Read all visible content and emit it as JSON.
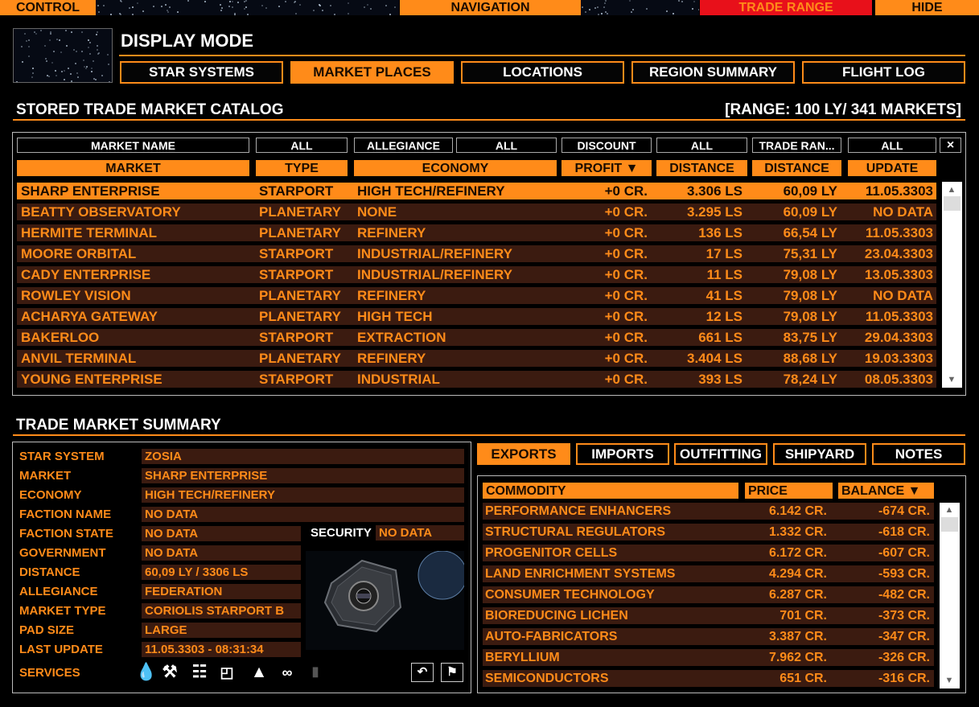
{
  "topbar": {
    "control": "CONTROL",
    "navigation": "NAVIGATION",
    "trade_range": "TRADE RANGE",
    "hide": "HIDE"
  },
  "display_mode": {
    "title": "DISPLAY MODE",
    "buttons": [
      "STAR SYSTEMS",
      "MARKET PLACES",
      "LOCATIONS",
      "REGION SUMMARY",
      "FLIGHT LOG"
    ],
    "active": "MARKET PLACES"
  },
  "catalog": {
    "title": "STORED TRADE MARKET CATALOG",
    "range_info": "[RANGE: 100 LY/ 341 MARKETS]",
    "filters": [
      "MARKET NAME",
      "ALL",
      "ALLEGIANCE",
      "ALL",
      "DISCOUNT",
      "ALL",
      "TRADE RAN...",
      "ALL"
    ],
    "clear_label": "×",
    "columns": [
      "MARKET",
      "TYPE",
      "ECONOMY",
      "PROFIT ▼",
      "DISTANCE",
      "DISTANCE",
      "UPDATE"
    ],
    "rows": [
      {
        "market": "SHARP ENTERPRISE",
        "type": "STARPORT",
        "economy": "HIGH TECH/REFINERY",
        "profit": "+0 CR.",
        "dist_ls": "3.306 LS",
        "dist_ly": "60,09 LY",
        "update": "11.05.3303"
      },
      {
        "market": "BEATTY OBSERVATORY",
        "type": "PLANETARY",
        "economy": "NONE",
        "profit": "+0 CR.",
        "dist_ls": "3.295 LS",
        "dist_ly": "60,09 LY",
        "update": "NO DATA"
      },
      {
        "market": "HERMITE TERMINAL",
        "type": "PLANETARY",
        "economy": "REFINERY",
        "profit": "+0 CR.",
        "dist_ls": "136 LS",
        "dist_ly": "66,54 LY",
        "update": "11.05.3303"
      },
      {
        "market": "MOORE ORBITAL",
        "type": "STARPORT",
        "economy": "INDUSTRIAL/REFINERY",
        "profit": "+0 CR.",
        "dist_ls": "17 LS",
        "dist_ly": "75,31 LY",
        "update": "23.04.3303"
      },
      {
        "market": "CADY ENTERPRISE",
        "type": "STARPORT",
        "economy": "INDUSTRIAL/REFINERY",
        "profit": "+0 CR.",
        "dist_ls": "11 LS",
        "dist_ly": "79,08 LY",
        "update": "13.05.3303"
      },
      {
        "market": "ROWLEY VISION",
        "type": "PLANETARY",
        "economy": "REFINERY",
        "profit": "+0 CR.",
        "dist_ls": "41 LS",
        "dist_ly": "79,08 LY",
        "update": "NO DATA"
      },
      {
        "market": "ACHARYA GATEWAY",
        "type": "PLANETARY",
        "economy": "HIGH TECH",
        "profit": "+0 CR.",
        "dist_ls": "12 LS",
        "dist_ly": "79,08 LY",
        "update": "11.05.3303"
      },
      {
        "market": "BAKERLOO",
        "type": "STARPORT",
        "economy": "EXTRACTION",
        "profit": "+0 CR.",
        "dist_ls": "661 LS",
        "dist_ly": "83,75 LY",
        "update": "29.04.3303"
      },
      {
        "market": "ANVIL TERMINAL",
        "type": "PLANETARY",
        "economy": "REFINERY",
        "profit": "+0 CR.",
        "dist_ls": "3.404 LS",
        "dist_ly": "88,68 LY",
        "update": "19.03.3303"
      },
      {
        "market": "YOUNG ENTERPRISE",
        "type": "STARPORT",
        "economy": "INDUSTRIAL",
        "profit": "+0 CR.",
        "dist_ls": "393 LS",
        "dist_ly": "78,24 LY",
        "update": "08.05.3303"
      }
    ]
  },
  "summary": {
    "title": "TRADE MARKET SUMMARY",
    "fields": [
      {
        "label": "STAR SYSTEM",
        "value": "ZOSIA"
      },
      {
        "label": "MARKET",
        "value": "SHARP ENTERPRISE"
      },
      {
        "label": "ECONOMY",
        "value": "HIGH TECH/REFINERY"
      },
      {
        "label": "FACTION NAME",
        "value": "NO DATA"
      },
      {
        "label": "FACTION STATE",
        "value": "NO DATA"
      },
      {
        "label": "GOVERNMENT",
        "value": "NO DATA"
      },
      {
        "label": "DISTANCE",
        "value": "60,09 LY / 3306 LS"
      },
      {
        "label": "ALLEGIANCE",
        "value": "FEDERATION"
      },
      {
        "label": "MARKET TYPE",
        "value": "CORIOLIS STARPORT B"
      },
      {
        "label": "PAD SIZE",
        "value": "LARGE"
      },
      {
        "label": "LAST UPDATE",
        "value": "11.05.3303 - 08:31:34"
      }
    ],
    "security_label": "SECURITY",
    "security_value": "NO DATA",
    "services_label": "SERVICES",
    "service_icons": [
      "refuel-icon",
      "repair-icon",
      "market-icon",
      "outfitting-icon",
      "shipyard-icon",
      "black-market-icon",
      "unavailable-service-icon"
    ]
  },
  "commodity": {
    "tabs": [
      "EXPORTS",
      "IMPORTS",
      "OUTFITTING",
      "SHIPYARD",
      "NOTES"
    ],
    "active_tab": "EXPORTS",
    "columns": [
      "COMMODITY",
      "PRICE",
      "BALANCE ▼"
    ],
    "rows": [
      {
        "name": "PERFORMANCE ENHANCERS",
        "price": "6.142 CR.",
        "balance": "-674 CR."
      },
      {
        "name": "STRUCTURAL REGULATORS",
        "price": "1.332 CR.",
        "balance": "-618 CR."
      },
      {
        "name": "PROGENITOR CELLS",
        "price": "6.172 CR.",
        "balance": "-607 CR."
      },
      {
        "name": "LAND ENRICHMENT SYSTEMS",
        "price": "4.294 CR.",
        "balance": "-593 CR."
      },
      {
        "name": "CONSUMER TECHNOLOGY",
        "price": "6.287 CR.",
        "balance": "-482 CR."
      },
      {
        "name": "BIOREDUCING LICHEN",
        "price": "701 CR.",
        "balance": "-373 CR."
      },
      {
        "name": "AUTO-FABRICATORS",
        "price": "3.387 CR.",
        "balance": "-347 CR."
      },
      {
        "name": "BERYLLIUM",
        "price": "7.962 CR.",
        "balance": "-326 CR."
      },
      {
        "name": "SEMICONDUCTORS",
        "price": "651 CR.",
        "balance": "-316 CR."
      }
    ]
  },
  "colors": {
    "accent": "#ff8b19",
    "row_bg": "#3b1b10",
    "alert": "#e8101a"
  }
}
